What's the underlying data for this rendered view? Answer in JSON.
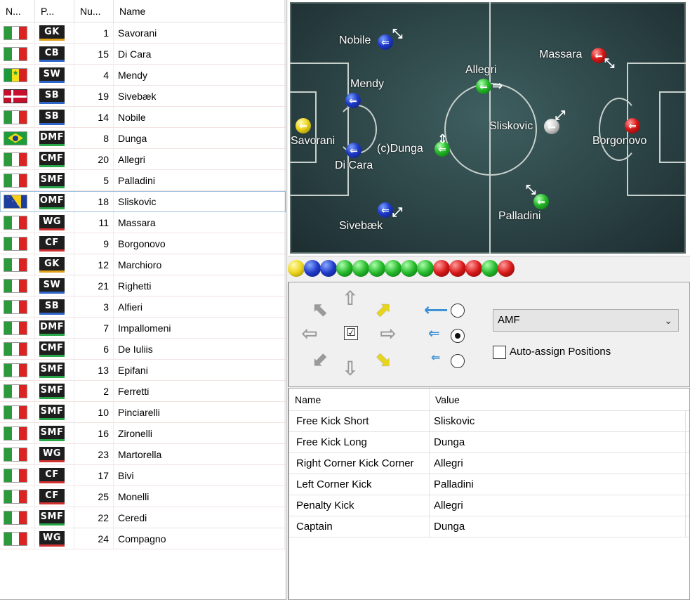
{
  "list": {
    "headers": {
      "nation": "N...",
      "position": "P...",
      "number": "Nu...",
      "name": "Name"
    },
    "rows": [
      {
        "flag": "it",
        "pos": "GK",
        "posclass": "gk",
        "num": "1",
        "name": "Savorani"
      },
      {
        "flag": "it",
        "pos": "CB",
        "posclass": "def",
        "num": "15",
        "name": "Di Cara"
      },
      {
        "flag": "sn",
        "pos": "SW",
        "posclass": "def",
        "num": "4",
        "name": "Mendy"
      },
      {
        "flag": "dk",
        "pos": "SB",
        "posclass": "def",
        "num": "19",
        "name": "Sivebæk"
      },
      {
        "flag": "it",
        "pos": "SB",
        "posclass": "def",
        "num": "14",
        "name": "Nobile"
      },
      {
        "flag": "br",
        "pos": "DMF",
        "posclass": "mid",
        "num": "8",
        "name": "Dunga"
      },
      {
        "flag": "it",
        "pos": "CMF",
        "posclass": "mid",
        "num": "20",
        "name": "Allegri"
      },
      {
        "flag": "it",
        "pos": "SMF",
        "posclass": "mid",
        "num": "5",
        "name": "Palladini"
      },
      {
        "flag": "ba",
        "pos": "OMF",
        "posclass": "mid",
        "num": "18",
        "name": "Sliskovic"
      },
      {
        "flag": "it",
        "pos": "WG",
        "posclass": "att",
        "num": "11",
        "name": "Massara"
      },
      {
        "flag": "it",
        "pos": "CF",
        "posclass": "att",
        "num": "9",
        "name": "Borgonovo"
      },
      {
        "flag": "it",
        "pos": "GK",
        "posclass": "gk",
        "num": "12",
        "name": "Marchioro"
      },
      {
        "flag": "it",
        "pos": "SW",
        "posclass": "def",
        "num": "21",
        "name": "Righetti"
      },
      {
        "flag": "it",
        "pos": "SB",
        "posclass": "def",
        "num": "3",
        "name": "Alfieri"
      },
      {
        "flag": "it",
        "pos": "DMF",
        "posclass": "mid",
        "num": "7",
        "name": "Impallomeni"
      },
      {
        "flag": "it",
        "pos": "CMF",
        "posclass": "mid",
        "num": "6",
        "name": "De Iuliis"
      },
      {
        "flag": "it",
        "pos": "SMF",
        "posclass": "mid",
        "num": "13",
        "name": "Epifani"
      },
      {
        "flag": "it",
        "pos": "SMF",
        "posclass": "mid",
        "num": "2",
        "name": "Ferretti"
      },
      {
        "flag": "it",
        "pos": "SMF",
        "posclass": "mid",
        "num": "10",
        "name": "Pinciarelli"
      },
      {
        "flag": "it",
        "pos": "SMF",
        "posclass": "mid",
        "num": "16",
        "name": "Zironelli"
      },
      {
        "flag": "it",
        "pos": "WG",
        "posclass": "att",
        "num": "23",
        "name": "Martorella"
      },
      {
        "flag": "it",
        "pos": "CF",
        "posclass": "att",
        "num": "17",
        "name": "Bivi"
      },
      {
        "flag": "it",
        "pos": "CF",
        "posclass": "att",
        "num": "25",
        "name": "Monelli"
      },
      {
        "flag": "it",
        "pos": "SMF",
        "posclass": "mid",
        "num": "22",
        "name": "Ceredi"
      },
      {
        "flag": "it",
        "pos": "WG",
        "posclass": "att",
        "num": "24",
        "name": "Compagno"
      }
    ],
    "selected_index": 8
  },
  "pitch": {
    "players": {
      "nobile": "Nobile",
      "mendy": "Mendy",
      "savorani": "Savorani",
      "dicara": "Di Cara",
      "sivebaek": "Sivebæk",
      "dunga": "(c)Dunga",
      "allegri": "Allegri",
      "palladini": "Palladini",
      "sliskovic": "Sliskovic",
      "massara": "Massara",
      "borgonovo": "Borgonovo"
    }
  },
  "balls": [
    "yellow",
    "blue",
    "blue",
    "green",
    "green",
    "green",
    "green",
    "green",
    "green",
    "red",
    "red",
    "red",
    "green",
    "red"
  ],
  "controls": {
    "position_select": "AMF",
    "auto_assign_label": "Auto-assign Positions",
    "auto_assign_checked": false,
    "speed_selected": 1
  },
  "props": {
    "headers": {
      "name": "Name",
      "value": "Value"
    },
    "rows": [
      {
        "name": "Free Kick Short",
        "value": "Sliskovic"
      },
      {
        "name": "Free Kick Long",
        "value": "Dunga"
      },
      {
        "name": "Right Corner Kick Corner",
        "value": "Allegri"
      },
      {
        "name": "Left Corner Kick",
        "value": "Palladini"
      },
      {
        "name": "Penalty Kick",
        "value": "Allegri"
      },
      {
        "name": "Captain",
        "value": "Dunga"
      }
    ]
  },
  "colors": {
    "selection_outline": "#9cc0e0",
    "pitch": "#2c4446",
    "speed_arrow": "#3a8fd6"
  }
}
